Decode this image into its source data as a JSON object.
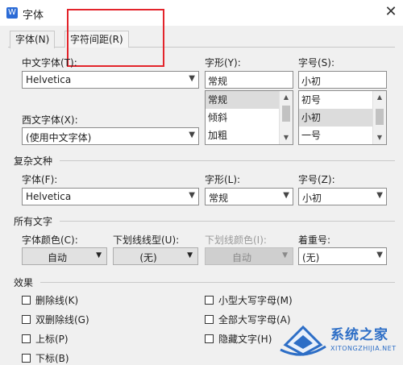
{
  "window": {
    "title": "字体",
    "app_icon": "W",
    "close_glyph": "✕"
  },
  "tabs": [
    {
      "label": "字体(N)",
      "active": true
    },
    {
      "label": "字符间距(R)",
      "active": false
    }
  ],
  "cn_font": {
    "label": "中文字体(T):",
    "value": "Helvetica"
  },
  "font_style": {
    "label": "字形(Y):",
    "value": "常规",
    "options": [
      "常规",
      "倾斜",
      "加粗"
    ],
    "selected": "常规"
  },
  "font_size": {
    "label": "字号(S):",
    "value": "小初",
    "options": [
      "初号",
      "小初",
      "一号"
    ],
    "selected": "小初"
  },
  "west_font": {
    "label": "西文字体(X):",
    "value": "(使用中文字体)"
  },
  "complex": {
    "heading": "复杂文种",
    "font_label": "字体(F):",
    "font_value": "Helvetica",
    "style_label": "字形(L):",
    "style_value": "常规",
    "size_label": "字号(Z):",
    "size_value": "小初"
  },
  "all_text": {
    "heading": "所有文字",
    "color_label": "字体颜色(C):",
    "color_value": "自动",
    "underline_label": "下划线线型(U):",
    "underline_value": "(无)",
    "underline_color_label": "下划线颜色(I):",
    "underline_color_value": "自动",
    "emphasis_label": "着重号:",
    "emphasis_value": "(无)"
  },
  "effects": {
    "heading": "效果",
    "left": [
      "删除线(K)",
      "双删除线(G)",
      "上标(P)",
      "下标(B)"
    ],
    "right": [
      "小型大写字母(M)",
      "全部大写字母(A)",
      "隐藏文字(H)"
    ]
  },
  "watermark": {
    "name": "系统之家",
    "domain": "XITONGZHIJIA.NET"
  },
  "colors": {
    "highlight": "#e3242b",
    "brand": "#2d6ec6"
  }
}
